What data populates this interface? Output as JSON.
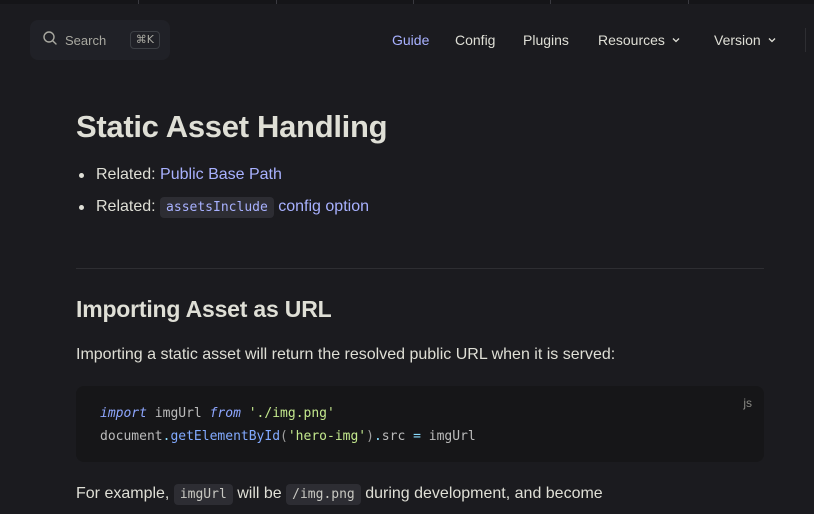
{
  "search": {
    "label": "Search",
    "shortcut": "⌘K"
  },
  "nav": {
    "guide": "Guide",
    "config": "Config",
    "plugins": "Plugins",
    "resources": "Resources",
    "version": "Version"
  },
  "content": {
    "title": "Static Asset Handling",
    "related": [
      {
        "prefix": "Related:",
        "link": "Public Base Path"
      },
      {
        "prefix": "Related:",
        "code": "assetsInclude",
        "link": "config option"
      }
    ],
    "section_title": "Importing Asset as URL",
    "intro": "Importing a static asset will return the resolved public URL when it is served:",
    "code_lang": "js",
    "code": {
      "line1": {
        "kw1": "import",
        "id": "imgUrl",
        "kw2": "from",
        "str": "'./img.png'"
      },
      "line2": {
        "obj": "document",
        "fn": "getElementById",
        "str": "'hero-img'",
        "prop": "src",
        "op": "=",
        "val": "imgUrl"
      }
    },
    "example": {
      "t1": "For example, ",
      "c1": "imgUrl",
      "t2": " will be ",
      "c2": "/img.png",
      "t3": " during development, and become"
    }
  },
  "colors": {
    "accent": "#a8b1ff",
    "background": "#1b1b1f",
    "text": "#dfdfd6"
  }
}
